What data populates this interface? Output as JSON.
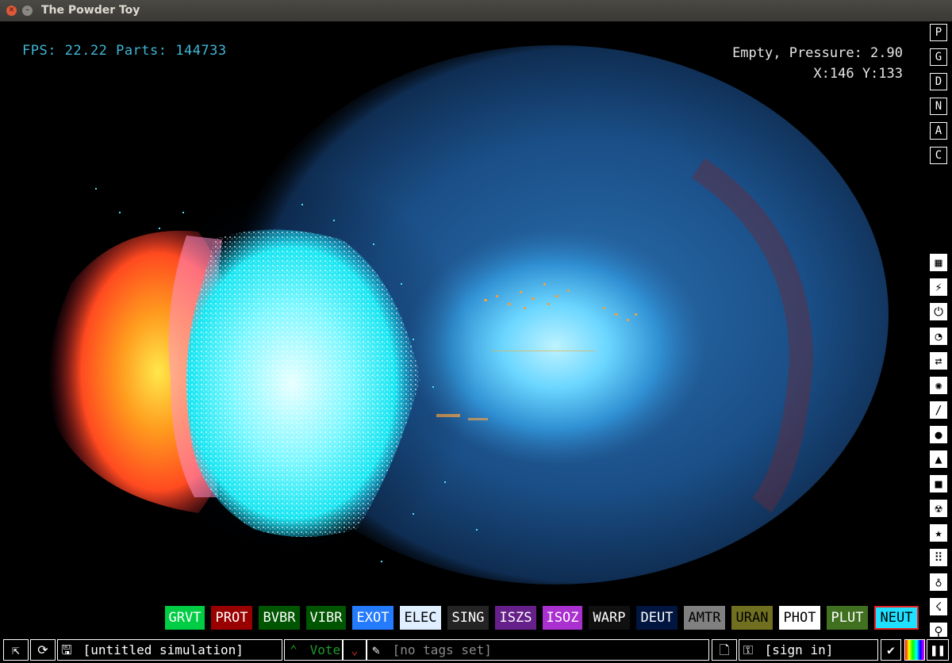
{
  "window": {
    "title": "The Powder Toy"
  },
  "hud": {
    "fps_text": "FPS: 22.22 Parts: 144733",
    "status_text": "Empty, Pressure: 2.90",
    "coords_text": "X:146 Y:133"
  },
  "render_modes": [
    "P",
    "G",
    "D",
    "N",
    "A",
    "C"
  ],
  "categories": [
    {
      "name": "walls-icon",
      "glyph": "▦"
    },
    {
      "name": "electronics-icon",
      "glyph": "⚡"
    },
    {
      "name": "powered-icon",
      "glyph": "⏻"
    },
    {
      "name": "sensors-icon",
      "glyph": "◔"
    },
    {
      "name": "force-icon",
      "glyph": "⇄"
    },
    {
      "name": "explosives-icon",
      "glyph": "✺"
    },
    {
      "name": "gases-icon",
      "glyph": "∕"
    },
    {
      "name": "liquids-icon",
      "glyph": "●"
    },
    {
      "name": "powders-icon",
      "glyph": "▲"
    },
    {
      "name": "solids-icon",
      "glyph": "■"
    },
    {
      "name": "radioactive-icon",
      "glyph": "☢"
    },
    {
      "name": "special-icon",
      "glyph": "★"
    },
    {
      "name": "life-icon",
      "glyph": "⠿"
    },
    {
      "name": "tools-icon",
      "glyph": "♁"
    },
    {
      "name": "favorites-icon",
      "glyph": "☇"
    },
    {
      "name": "search-icon",
      "glyph": "⚲"
    }
  ],
  "elements": [
    {
      "label": "GRVT",
      "bg": "#00cc44",
      "fg": "#ffffff"
    },
    {
      "label": "PROT",
      "bg": "#990000",
      "fg": "#ffffff"
    },
    {
      "label": "BVBR",
      "bg": "#005500",
      "fg": "#ffffff"
    },
    {
      "label": "VIBR",
      "bg": "#005500",
      "fg": "#ffffff"
    },
    {
      "label": "EXOT",
      "bg": "#247bfe",
      "fg": "#ffffff"
    },
    {
      "label": "ELEC",
      "bg": "#dfefff",
      "fg": "#000000"
    },
    {
      "label": "SING",
      "bg": "#242424",
      "fg": "#ffffff"
    },
    {
      "label": "ISZS",
      "bg": "#662089",
      "fg": "#ffffff"
    },
    {
      "label": "ISOZ",
      "bg": "#aa30d0",
      "fg": "#ffffff"
    },
    {
      "label": "WARP",
      "bg": "#101010",
      "fg": "#ffffff"
    },
    {
      "label": "DEUT",
      "bg": "#00153f",
      "fg": "#ffffff"
    },
    {
      "label": "AMTR",
      "bg": "#808080",
      "fg": "#000000"
    },
    {
      "label": "URAN",
      "bg": "#707020",
      "fg": "#000000"
    },
    {
      "label": "PHOT",
      "bg": "#ffffff",
      "fg": "#000000"
    },
    {
      "label": "PLUT",
      "bg": "#407020",
      "fg": "#ffffff"
    },
    {
      "label": "NEUT",
      "bg": "#20e0ff",
      "fg": "#000000",
      "active": true
    }
  ],
  "bottom": {
    "open_icon": "open-save-icon",
    "reload_icon": "reload-icon",
    "save_name": "[untitled simulation]",
    "vote_label": "Vote",
    "tags_text": "[no tags set]",
    "sign_in_label": "[sign in]",
    "colors": {
      "vote": "#1e9b28",
      "downvote": "#b82a1e"
    }
  }
}
